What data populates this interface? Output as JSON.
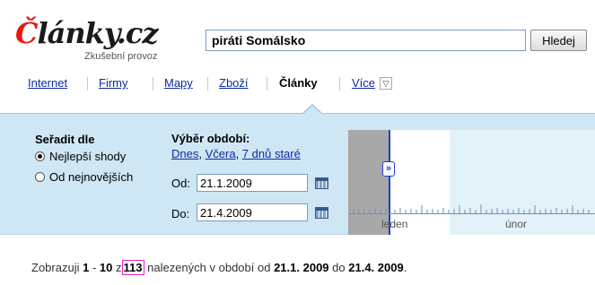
{
  "brand": {
    "logo_prefix": "Č",
    "logo_rest": "lánky.cz",
    "subtitle": "Zkušební provoz"
  },
  "search": {
    "value": "piráti Somálsko",
    "button_label": "Hledej"
  },
  "nav": {
    "items": [
      {
        "label": "Internet",
        "active": false
      },
      {
        "label": "Firmy",
        "active": false
      },
      {
        "label": "Mapy",
        "active": false
      },
      {
        "label": "Zboží",
        "active": false
      },
      {
        "label": "Články",
        "active": true
      },
      {
        "label": "Více",
        "active": false
      }
    ],
    "more_icon": "chevron-down-icon"
  },
  "sort": {
    "title": "Seřadit dle",
    "options": [
      {
        "label": "Nejlepší shody",
        "selected": true
      },
      {
        "label": "Od nejnovějších",
        "selected": false
      }
    ]
  },
  "period": {
    "title": "Výběr období:",
    "links": [
      "Dnes",
      "Včera",
      "7 dnů staré"
    ],
    "from_label": "Od:",
    "from_value": "21.1.2009",
    "to_label": "Do:",
    "to_value": "21.4.2009",
    "calendar_icon": "calendar-icon"
  },
  "timeline": {
    "months": [
      "leden",
      "únor"
    ],
    "handle_symbol": "»"
  },
  "results": {
    "prefix": "Zobrazuji",
    "from": "1",
    "dash": "-",
    "to": "10",
    "of_word": "z",
    "total": "113",
    "middle": "nalezených v období od",
    "date_from": "21.1. 2009",
    "to_word": "do",
    "date_to": "21.4. 2009",
    "end": "."
  },
  "colors": {
    "accent_red": "#e31b13",
    "link_blue": "#0b2aa8",
    "panel_blue": "#cfe6f4",
    "highlight_magenta": "#e020c0"
  }
}
